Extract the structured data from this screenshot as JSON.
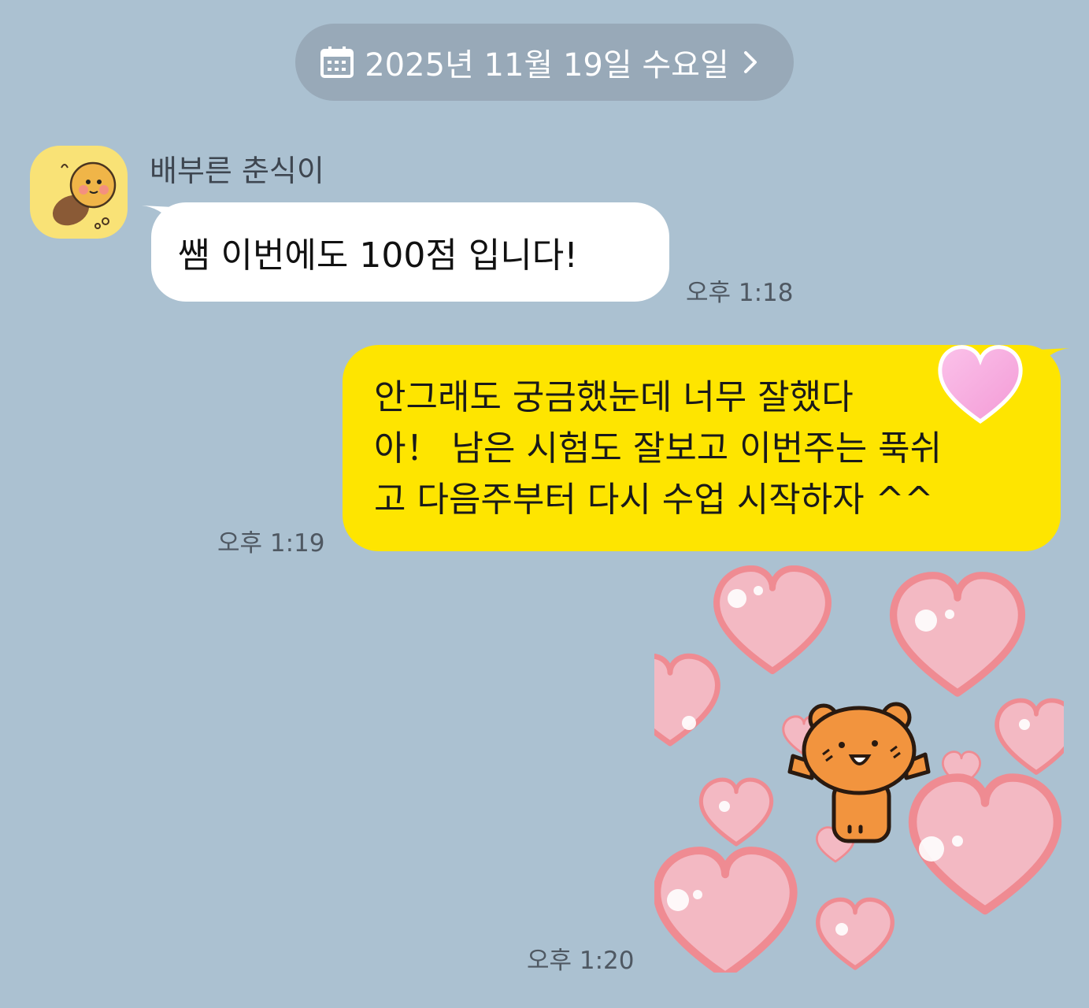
{
  "date_header": {
    "label": "2025년 11월 19일 수요일",
    "icon": "calendar-icon",
    "chevron": "chevron-right-icon"
  },
  "messages": [
    {
      "direction": "incoming",
      "sender": "배부른 춘식이",
      "text": "쌤 이번에도 100점 입니다!",
      "time": "오후 1:18"
    },
    {
      "direction": "outgoing",
      "lines": [
        "안그래도 궁금했눈데 너무 잘했다",
        "아！ 남은 시험도 잘보고 이번주는 푹쉬",
        "고 다음주부터 다시 수업 시작하자 ^^"
      ],
      "emoji": "pink-heart-emoji",
      "time": "오후 1:19"
    },
    {
      "direction": "outgoing",
      "type": "sticker",
      "sticker": "bear-with-hearts-sticker",
      "time": "오후 1:20"
    }
  ],
  "colors": {
    "background": "#abc1d1",
    "outgoing_bubble": "#fee500",
    "incoming_bubble": "#ffffff",
    "date_pill": "#98a9b8"
  }
}
